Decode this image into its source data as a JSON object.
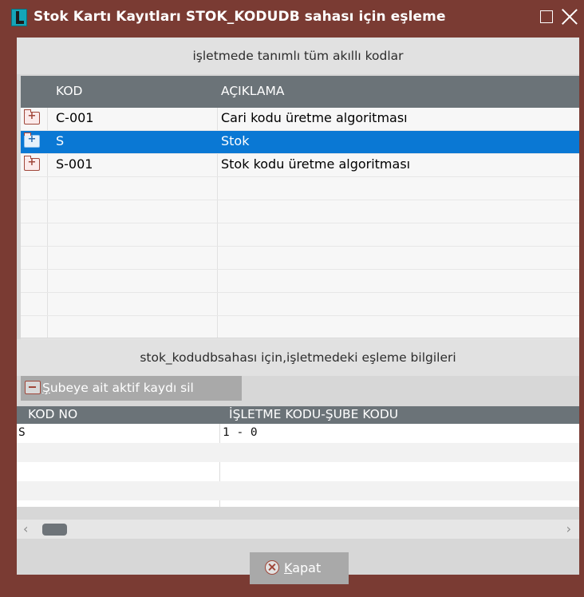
{
  "window": {
    "title": "Stok Kartı Kayıtları STOK_KODUDB sahası için eşleme"
  },
  "top_section": {
    "header": "işletmede tanımlı tüm akıllı kodlar",
    "columns": [
      "KOD",
      "AÇIKLAMA"
    ],
    "rows": [
      {
        "kod": "C-001",
        "aciklama": "Cari kodu üretme algoritması",
        "selected": false
      },
      {
        "kod": "S",
        "aciklama": "Stok",
        "selected": true
      },
      {
        "kod": "S-001",
        "aciklama": "Stok kodu üretme algoritması",
        "selected": false
      }
    ]
  },
  "bottom_section": {
    "header": "stok_kodudbsahası için,işletmedeki eşleme bilgileri",
    "delete_button": {
      "first_letter": "Ş",
      "rest": "ubeye ait aktif kaydı sil"
    },
    "columns": [
      "KOD NO",
      "İŞLETME KODU-ŞUBE KODU"
    ],
    "rows": [
      {
        "kod_no": "S",
        "isletme_sube": "1 - 0"
      }
    ]
  },
  "footer": {
    "close_button": {
      "first_letter": "K",
      "rest": "apat"
    }
  },
  "colors": {
    "window_frame": "#7a3b33",
    "grid_header": "#6b7378",
    "selection": "#0a78d4"
  }
}
